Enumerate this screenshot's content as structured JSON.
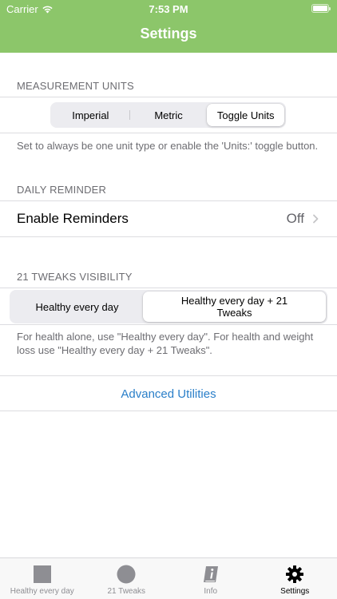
{
  "status_bar": {
    "carrier": "Carrier",
    "time": "7:53 PM"
  },
  "nav": {
    "title": "Settings"
  },
  "measurement": {
    "header": "MEASUREMENT UNITS",
    "segments": [
      "Imperial",
      "Metric",
      "Toggle Units"
    ],
    "selected": "Toggle Units",
    "footer": "Set to always be one unit type or enable the 'Units:' toggle button."
  },
  "reminder": {
    "header": "DAILY REMINDER",
    "label": "Enable Reminders",
    "value": "Off"
  },
  "tweaks": {
    "header": "21 TWEAKS VISIBILITY",
    "segments": [
      "Healthy every day",
      "Healthy every day + 21 Tweaks"
    ],
    "selected": "Healthy every day + 21 Tweaks",
    "footer": "For health alone, use \"Healthy every day\". For health and weight loss use \"Healthy every day + 21 Tweaks\"."
  },
  "advanced": {
    "label": "Advanced Utilities"
  },
  "tabs": [
    {
      "label": "Healthy every day",
      "icon": "square-icon"
    },
    {
      "label": "21 Tweaks",
      "icon": "circle-icon"
    },
    {
      "label": "Info",
      "icon": "info-book-icon"
    },
    {
      "label": "Settings",
      "icon": "gear-icon",
      "active": true
    }
  ],
  "colors": {
    "header_green": "#8cc66a",
    "link_blue": "#2a7fc9",
    "tab_inactive": "#8e8e93"
  }
}
